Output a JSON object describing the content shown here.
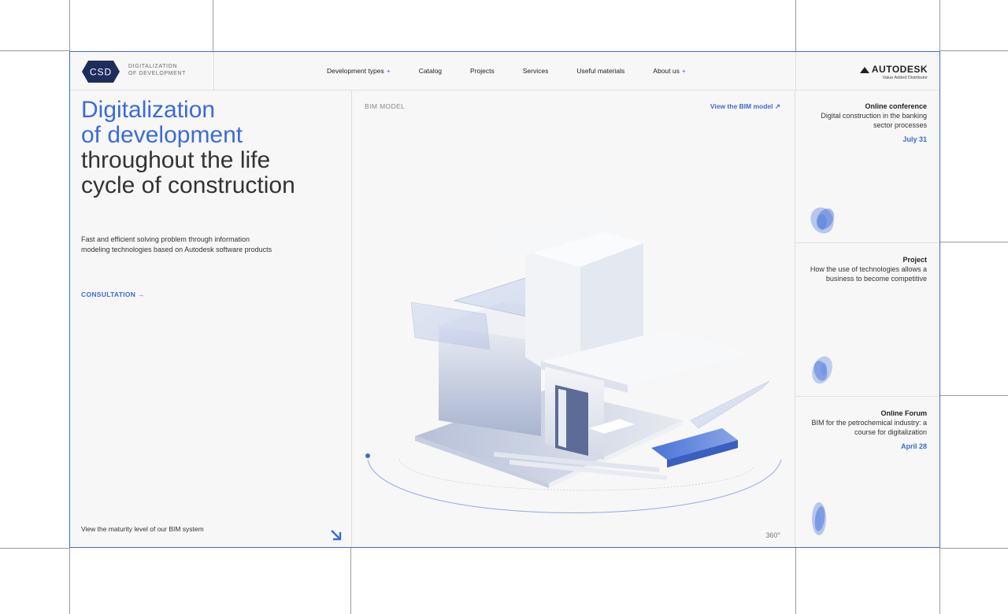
{
  "header": {
    "logo_text": "CSD",
    "logo_caption_line1": "DIGITALIZATION",
    "logo_caption_line2": "OF DEVELOPMENT",
    "nav": [
      {
        "label": "Development types",
        "has_plus": true
      },
      {
        "label": "Catalog",
        "has_plus": false
      },
      {
        "label": "Projects",
        "has_plus": false
      },
      {
        "label": "Services",
        "has_plus": false
      },
      {
        "label": "Useful materials",
        "has_plus": false
      },
      {
        "label": "About us",
        "has_plus": true
      }
    ],
    "plus_symbol": "+",
    "brand_name": "AUTODESK",
    "brand_sub": "Value Added Distributor"
  },
  "hero": {
    "line1": "Digitalization",
    "line2": "of development",
    "line3": "throughout the life",
    "line4": "cycle of construction",
    "lead": "Fast and efficient solving problem through information modeling technologies based on Autodesk software products",
    "cta": "CONSULTATION →",
    "maturity": "View the maturity level of our BIM system"
  },
  "model": {
    "label": "BIM MODEL",
    "view_link": "View the BIM model ↗",
    "rotation": "360°"
  },
  "events": [
    {
      "type": "Online conference",
      "desc": "Digital construction in the banking sector processes",
      "date": "July 31"
    },
    {
      "type": "Project",
      "desc": "How the use of technologies allows a business to become competitive",
      "date": ""
    },
    {
      "type": "Online Forum",
      "desc": "BIM for the petrochemical industry: a course for digitalization",
      "date": "April 28"
    }
  ],
  "colors": {
    "accent": "#3d6bd6",
    "frame_bg": "#f7f7f7",
    "logo_bg": "#1f2d5c"
  }
}
